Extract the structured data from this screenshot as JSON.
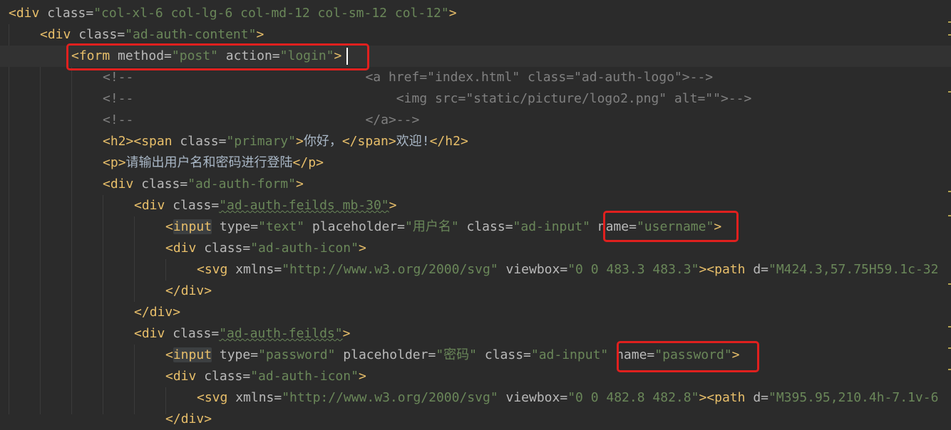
{
  "code_lines": [
    {
      "id": "l1",
      "parts": [
        [
          "br",
          "<"
        ],
        [
          "t",
          "div"
        ],
        [
          "a",
          " class="
        ],
        [
          "v",
          "\"col-xl-6 col-lg-6 col-md-12 col-sm-12 col-12\""
        ],
        [
          "br",
          ">"
        ]
      ]
    },
    {
      "id": "l2",
      "parts": [
        [
          "br",
          "<"
        ],
        [
          "t",
          "div"
        ],
        [
          "a",
          " class="
        ],
        [
          "v",
          "\"ad-auth-content\""
        ],
        [
          "br",
          ">"
        ]
      ]
    },
    {
      "id": "l3",
      "parts": [
        [
          "br",
          "<"
        ],
        [
          "t",
          "form"
        ],
        [
          "a",
          " method="
        ],
        [
          "v",
          "\"post\""
        ],
        [
          "a",
          " action="
        ],
        [
          "v",
          "\"login\""
        ],
        [
          "br",
          ">"
        ]
      ]
    },
    {
      "id": "l4",
      "parts": [
        [
          "c",
          "<!--                              <a href=\"index.html\" class=\"ad-auth-logo\">-->"
        ]
      ]
    },
    {
      "id": "l5",
      "parts": [
        [
          "c",
          "<!--                                  <img src=\"static/picture/logo2.png\" alt=\"\">-->"
        ]
      ]
    },
    {
      "id": "l6",
      "parts": [
        [
          "c",
          "<!--                              </a>-->"
        ]
      ]
    },
    {
      "id": "l7",
      "parts": [
        [
          "br",
          "<"
        ],
        [
          "t",
          "h2"
        ],
        [
          "br",
          "><"
        ],
        [
          "t",
          "span"
        ],
        [
          "a",
          " class="
        ],
        [
          "v",
          "\"primary\""
        ],
        [
          "br",
          ">"
        ],
        [
          "txt",
          "你好，"
        ],
        [
          "br",
          "</"
        ],
        [
          "t",
          "span"
        ],
        [
          "br",
          ">"
        ],
        [
          "txt",
          "欢迎!"
        ],
        [
          "br",
          "</"
        ],
        [
          "t",
          "h2"
        ],
        [
          "br",
          ">"
        ]
      ]
    },
    {
      "id": "l8",
      "parts": [
        [
          "br",
          "<"
        ],
        [
          "t",
          "p"
        ],
        [
          "br",
          ">"
        ],
        [
          "txt",
          "请输出用户名和密码进行登陆"
        ],
        [
          "br",
          "</"
        ],
        [
          "t",
          "p"
        ],
        [
          "br",
          ">"
        ]
      ]
    },
    {
      "id": "l9",
      "parts": [
        [
          "br",
          "<"
        ],
        [
          "t",
          "div"
        ],
        [
          "a",
          " class="
        ],
        [
          "v",
          "\"ad-auth-form\""
        ],
        [
          "br",
          ">"
        ]
      ]
    },
    {
      "id": "l10",
      "parts": [
        [
          "br",
          "<"
        ],
        [
          "t",
          "div"
        ],
        [
          "a",
          " class="
        ],
        [
          "v",
          "\"ad-auth-feilds mb-30\""
        ],
        [
          "br",
          ">"
        ]
      ]
    },
    {
      "id": "l11",
      "parts": [
        [
          "br",
          "<"
        ],
        [
          "t",
          "input"
        ],
        [
          "a",
          " type="
        ],
        [
          "v",
          "\"text\""
        ],
        [
          "a",
          " placeholder="
        ],
        [
          "v",
          "\"用户名\""
        ],
        [
          "a",
          " class="
        ],
        [
          "v",
          "\"ad-input\""
        ],
        [
          "a",
          " name="
        ],
        [
          "v",
          "\"username\""
        ],
        [
          "br",
          ">"
        ]
      ]
    },
    {
      "id": "l12",
      "parts": [
        [
          "br",
          "<"
        ],
        [
          "t",
          "div"
        ],
        [
          "a",
          " class="
        ],
        [
          "v",
          "\"ad-auth-icon\""
        ],
        [
          "br",
          ">"
        ]
      ]
    },
    {
      "id": "l13",
      "parts": [
        [
          "br",
          "<"
        ],
        [
          "t",
          "svg"
        ],
        [
          "a",
          " xmlns="
        ],
        [
          "v",
          "\"http://www.w3.org/2000/svg\""
        ],
        [
          "a",
          " viewbox="
        ],
        [
          "v",
          "\"0 0 483.3 483.3\""
        ],
        [
          "br",
          "><"
        ],
        [
          "t",
          "path"
        ],
        [
          "a",
          " d="
        ],
        [
          "v",
          "\"M424.3,57.75H59.1c-32"
        ]
      ]
    },
    {
      "id": "l14",
      "parts": [
        [
          "br",
          "</"
        ],
        [
          "t",
          "div"
        ],
        [
          "br",
          ">"
        ]
      ]
    },
    {
      "id": "l15",
      "parts": [
        [
          "br",
          "</"
        ],
        [
          "t",
          "div"
        ],
        [
          "br",
          ">"
        ]
      ]
    },
    {
      "id": "l16",
      "parts": [
        [
          "br",
          "<"
        ],
        [
          "t",
          "div"
        ],
        [
          "a",
          " class="
        ],
        [
          "v",
          "\"ad-auth-feilds\""
        ],
        [
          "br",
          ">"
        ]
      ]
    },
    {
      "id": "l17",
      "parts": [
        [
          "br",
          "<"
        ],
        [
          "t",
          "input"
        ],
        [
          "a",
          " type="
        ],
        [
          "v",
          "\"password\""
        ],
        [
          "a",
          " placeholder="
        ],
        [
          "v",
          "\"密码\""
        ],
        [
          "a",
          " class="
        ],
        [
          "v",
          "\"ad-input\""
        ],
        [
          "a",
          " name="
        ],
        [
          "v",
          "\"password\""
        ],
        [
          "br",
          ">"
        ]
      ]
    },
    {
      "id": "l18",
      "parts": [
        [
          "br",
          "<"
        ],
        [
          "t",
          "div"
        ],
        [
          "a",
          " class="
        ],
        [
          "v",
          "\"ad-auth-icon\""
        ],
        [
          "br",
          ">"
        ]
      ]
    },
    {
      "id": "l19",
      "parts": [
        [
          "br",
          "<"
        ],
        [
          "t",
          "svg"
        ],
        [
          "a",
          " xmlns="
        ],
        [
          "v",
          "\"http://www.w3.org/2000/svg\""
        ],
        [
          "a",
          " viewbox="
        ],
        [
          "v",
          "\"0 0 482.8 482.8\""
        ],
        [
          "br",
          "><"
        ],
        [
          "t",
          "path"
        ],
        [
          "a",
          " d="
        ],
        [
          "v",
          "\"M395.95,210.4h-7.1v-6"
        ]
      ]
    },
    {
      "id": "l20",
      "parts": [
        [
          "br",
          "</"
        ],
        [
          "t",
          "div"
        ],
        [
          "br",
          ">"
        ]
      ]
    }
  ],
  "colors": {
    "background": "#2b2b2b",
    "current_line": "#323232",
    "tag": "#e8bf6a",
    "attr": "#bababa",
    "value": "#6a8759",
    "comment": "#808080",
    "highlight_box": "#e0201e"
  }
}
